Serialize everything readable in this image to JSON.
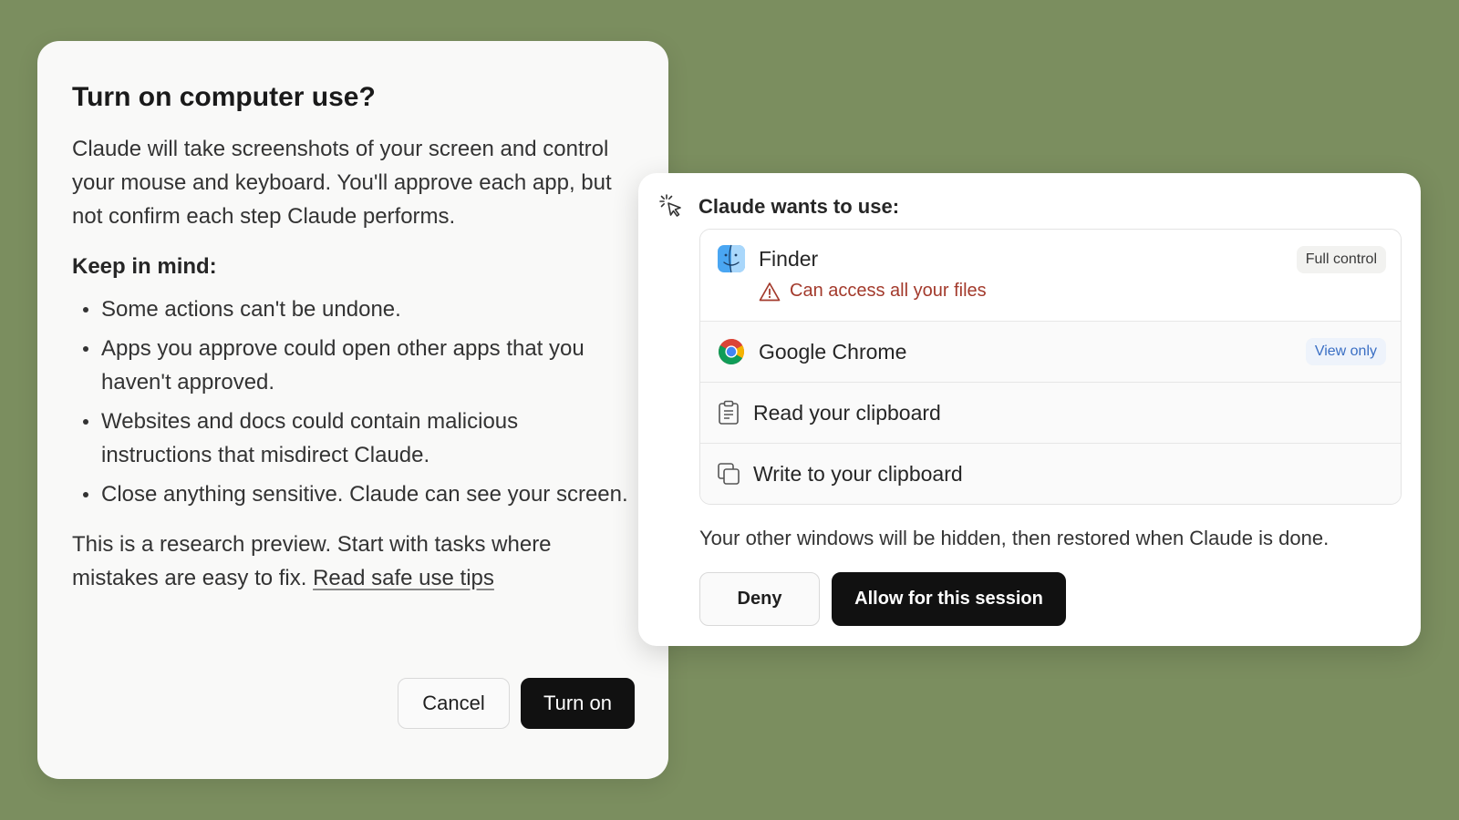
{
  "left_dialog": {
    "title": "Turn on computer use?",
    "intro": "Claude will take screenshots of your screen and control your mouse and keyboard. You'll approve each app, but not confirm each step Claude performs.",
    "subhead": "Keep in mind:",
    "bullets": [
      "Some actions can't be undone.",
      "Apps you approve could open other apps that you haven't approved.",
      "Websites and docs could contain malicious instructions that misdirect Claude.",
      "Close anything sensitive. Claude can see your screen."
    ],
    "note": "This is a research preview. Start with tasks where mistakes are easy to fix. ",
    "link_label": "Read safe use tips",
    "cancel_label": "Cancel",
    "turn_on_label": "Turn on"
  },
  "right_dialog": {
    "title": "Claude wants to use:",
    "permissions": [
      {
        "name": "Finder",
        "icon": "finder-icon",
        "badge": "Full control",
        "warning": "Can access all your files"
      },
      {
        "name": "Google Chrome",
        "icon": "chrome-icon",
        "badge": "View only"
      },
      {
        "name": "Read your clipboard",
        "icon": "clipboard-icon"
      },
      {
        "name": "Write to your clipboard",
        "icon": "copy-icon"
      }
    ],
    "footer": "Your other windows will be hidden, then restored when Claude is done.",
    "deny_label": "Deny",
    "allow_label": "Allow for this session"
  },
  "colors": {
    "background": "#7b8e5f",
    "warning": "#a33a2c",
    "view_only": "#3a6fc4",
    "primary_button": "#111111"
  }
}
